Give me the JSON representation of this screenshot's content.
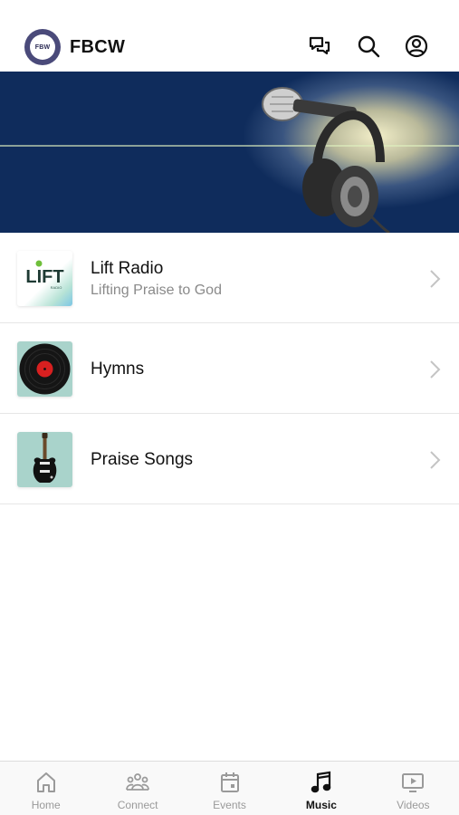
{
  "app": {
    "title": "FBCW",
    "logo_text": "FBW"
  },
  "header_icons": [
    "chat-icon",
    "search-icon",
    "profile-icon"
  ],
  "music_list": [
    {
      "title": "Lift Radio",
      "subtitle": "Lifting Praise to God",
      "thumb_text": "LIFT",
      "thumb_subtext": "RADIO"
    },
    {
      "title": "Hymns",
      "subtitle": ""
    },
    {
      "title": "Praise Songs",
      "subtitle": ""
    }
  ],
  "tabs": [
    {
      "label": "Home",
      "icon": "home-icon",
      "active": false
    },
    {
      "label": "Connect",
      "icon": "people-icon",
      "active": false
    },
    {
      "label": "Events",
      "icon": "calendar-icon",
      "active": false
    },
    {
      "label": "Music",
      "icon": "music-note-icon",
      "active": true
    },
    {
      "label": "Videos",
      "icon": "video-icon",
      "active": false
    }
  ],
  "colors": {
    "banner_bg": "#0f2c5c",
    "logo_bg": "#4a4a7a",
    "accent_text": "#111111",
    "muted_text": "#8a8a8a"
  }
}
